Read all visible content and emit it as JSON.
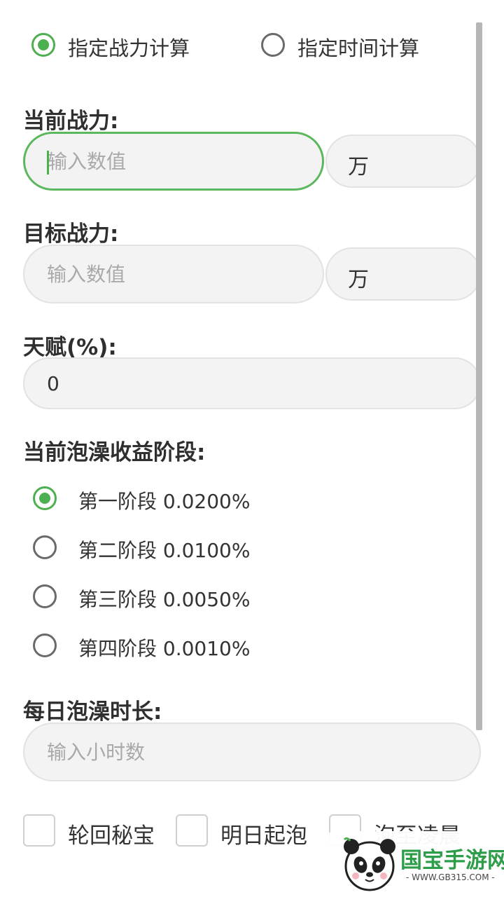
{
  "mode": {
    "option_power": "指定战力计算",
    "option_time": "指定时间计算",
    "selected": "power"
  },
  "current_power": {
    "label": "当前战力:",
    "placeholder": "输入数值",
    "unit": "万"
  },
  "target_power": {
    "label": "目标战力:",
    "placeholder": "输入数值",
    "unit": "万"
  },
  "talent": {
    "label": "天赋(%):",
    "value": "0"
  },
  "stage": {
    "label": "当前泡澡收益阶段:",
    "options": [
      {
        "label": "第一阶段 0.0200%",
        "selected": true
      },
      {
        "label": "第二阶段 0.0100%",
        "selected": false
      },
      {
        "label": "第三阶段 0.0050%",
        "selected": false
      },
      {
        "label": "第四阶段 0.0010%",
        "selected": false
      }
    ]
  },
  "daily": {
    "label": "每日泡澡时长:",
    "placeholder": "输入小时数"
  },
  "checks": {
    "items": [
      "轮回秘宝",
      "明日起泡",
      "泡至凌晨"
    ]
  },
  "watermark": {
    "brand": "国宝手游网",
    "site": "- WWW.GB315.COM -"
  },
  "colors": {
    "accent": "#4caf50",
    "field_bg": "#f3f3f3",
    "field_border": "#e2e2e2"
  }
}
